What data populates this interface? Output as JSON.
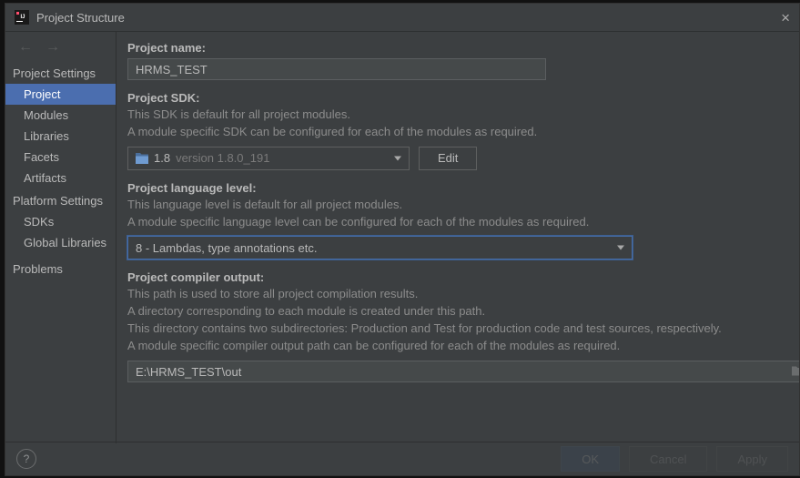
{
  "window": {
    "title": "Project Structure"
  },
  "nav": {
    "group1": "Project Settings",
    "group2": "Platform Settings",
    "items1": [
      "Project",
      "Modules",
      "Libraries",
      "Facets",
      "Artifacts"
    ],
    "items2": [
      "SDKs",
      "Global Libraries"
    ],
    "problems": "Problems"
  },
  "project": {
    "name_label": "Project name:",
    "name_value": "HRMS_TEST",
    "sdk_label": "Project SDK:",
    "sdk_desc1": "This SDK is default for all project modules.",
    "sdk_desc2": "A module specific SDK can be configured for each of the modules as required.",
    "sdk_value": "1.8",
    "sdk_version": "version 1.8.0_191",
    "edit": "Edit",
    "lang_label": "Project language level:",
    "lang_desc1": "This language level is default for all project modules.",
    "lang_desc2": "A module specific language level can be configured for each of the modules as required.",
    "lang_value": "8 - Lambdas, type annotations etc.",
    "out_label": "Project compiler output:",
    "out_desc1": "This path is used to store all project compilation results.",
    "out_desc2": "A directory corresponding to each module is created under this path.",
    "out_desc3": "This directory contains two subdirectories: Production and Test for production code and test sources, respectively.",
    "out_desc4": "A module specific compiler output path can be configured for each of the modules as required.",
    "out_value": "E:\\HRMS_TEST\\out"
  },
  "footer": {
    "ok": "OK",
    "cancel": "Cancel",
    "apply": "Apply"
  }
}
